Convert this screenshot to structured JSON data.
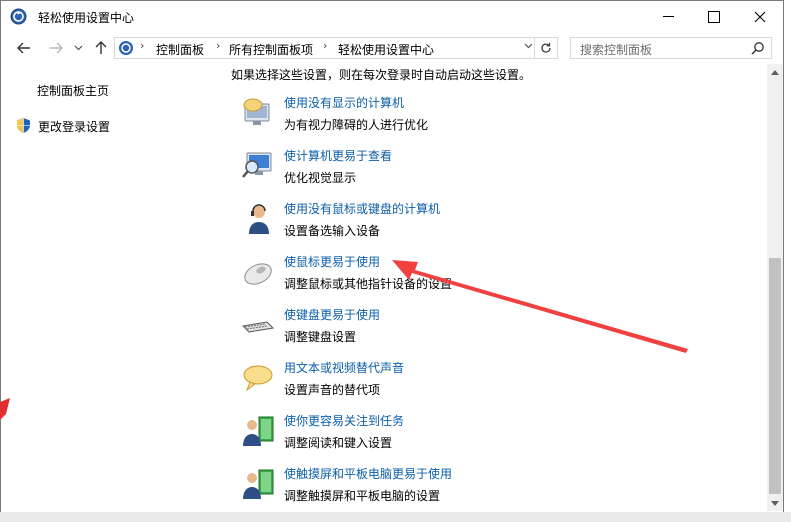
{
  "window": {
    "title": "轻松使用设置中心"
  },
  "address": {
    "crumbs": [
      "控制面板",
      "所有控制面板项",
      "轻松使用设置中心"
    ]
  },
  "search": {
    "placeholder": "搜索控制面板"
  },
  "sidebar": {
    "home": "控制面板主页",
    "login_settings": "更改登录设置"
  },
  "main": {
    "intro": "如果选择这些设置，则在每次登录时自动启动这些设置。",
    "items": [
      {
        "link": "使用没有显示的计算机",
        "desc": "为有视力障碍的人进行优化",
        "icon": "monitor-speech-icon"
      },
      {
        "link": "使计算机更易于查看",
        "desc": "优化视觉显示",
        "icon": "magnifier-monitor-icon"
      },
      {
        "link": "使用没有鼠标或键盘的计算机",
        "desc": "设置备选输入设备",
        "icon": "person-headset-icon"
      },
      {
        "link": "使鼠标更易于使用",
        "desc": "调整鼠标或其他指针设备的设置",
        "icon": "mouse-icon"
      },
      {
        "link": "使键盘更易于使用",
        "desc": "调整键盘设置",
        "icon": "keyboard-icon"
      },
      {
        "link": "用文本或视频替代声音",
        "desc": "设置声音的替代项",
        "icon": "speech-bubble-icon"
      },
      {
        "link": "使你更容易关注到任务",
        "desc": "调整阅读和键入设置",
        "icon": "person-book-icon"
      },
      {
        "link": "使触摸屏和平板电脑更易于使用",
        "desc": "调整触摸屏和平板电脑的设置",
        "icon": "person-tablet-icon"
      }
    ]
  },
  "colors": {
    "link": "#0b5ea8",
    "annotation_arrow": "#f04040"
  }
}
